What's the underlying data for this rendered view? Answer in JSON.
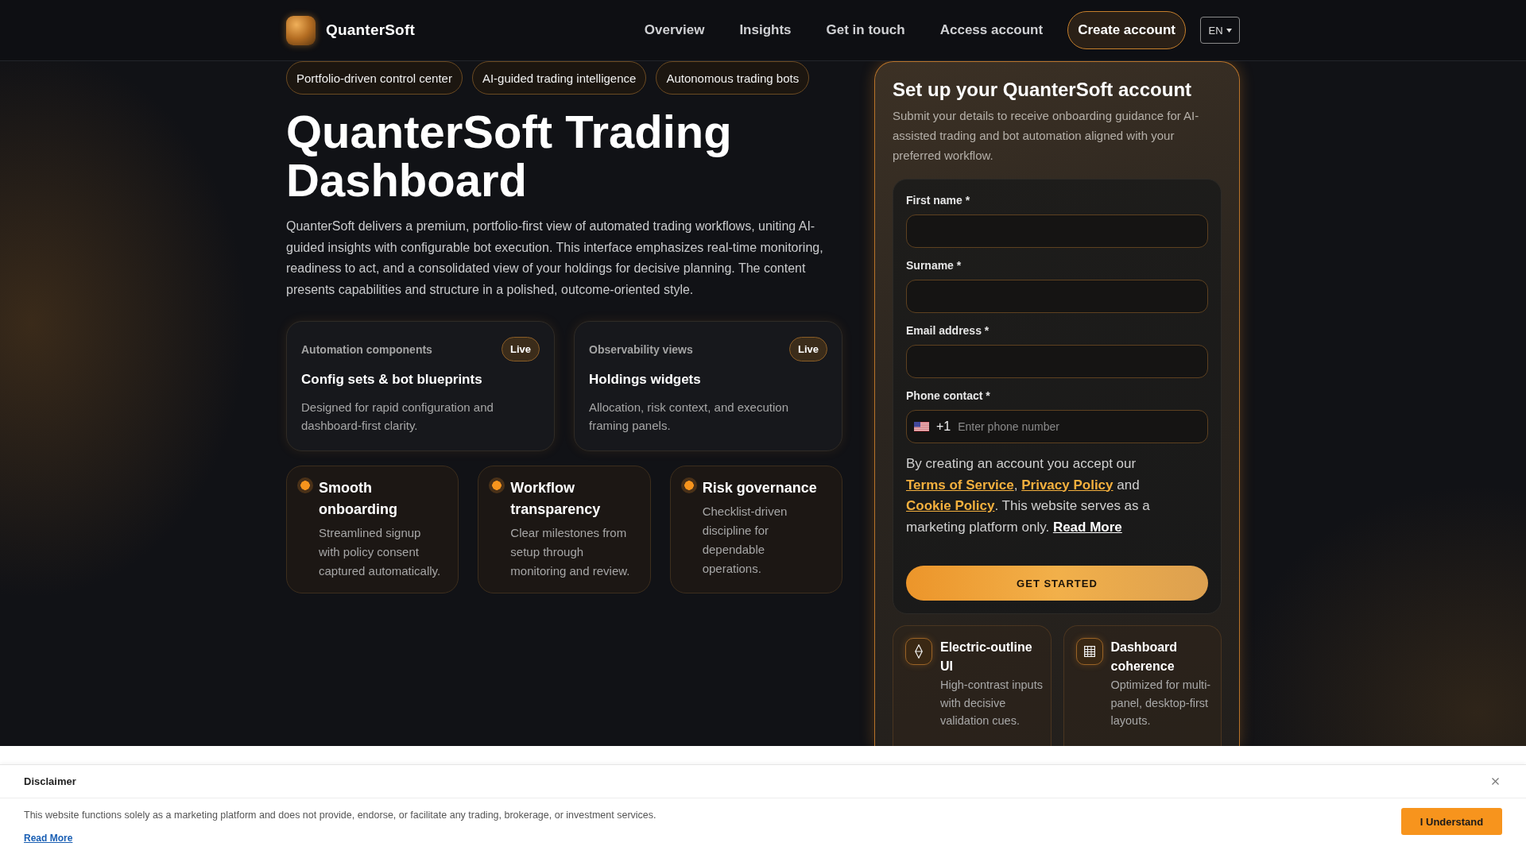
{
  "header": {
    "brand": "QuanterSoft",
    "nav": [
      "Overview",
      "Insights",
      "Get in touch",
      "Access account"
    ],
    "cta": "Create account",
    "language": "EN"
  },
  "hero": {
    "tags": [
      "Portfolio-driven control center",
      "AI-guided trading intelligence",
      "Autonomous trading bots"
    ],
    "title": "QuanterSoft Trading Dashboard",
    "description": "QuanterSoft delivers a premium, portfolio-first view of automated trading workflows, uniting AI-guided insights with configurable bot execution. This interface emphasizes real-time monitoring, readiness to act, and a consolidated view of your holdings for decisive planning. The content presents capabilities and structure in a polished, outcome-oriented style."
  },
  "status_cards": [
    {
      "label": "Automation components",
      "badge": "Live",
      "title": "Config sets & bot blueprints",
      "description": "Designed for rapid configuration and dashboard-first clarity."
    },
    {
      "label": "Observability views",
      "badge": "Live",
      "title": "Holdings widgets",
      "description": "Allocation, risk context, and execution framing panels."
    }
  ],
  "highlights": [
    {
      "title": "Smooth onboarding",
      "description": "Streamlined signup with policy consent captured automatically."
    },
    {
      "title": "Workflow transparency",
      "description": "Clear milestones from setup through monitoring and review."
    },
    {
      "title": "Risk governance",
      "description": "Checklist-driven discipline for dependable operations."
    }
  ],
  "signup": {
    "title": "Set up your QuanterSoft account",
    "subtitle": "Submit your details to receive onboarding guidance for AI-assisted trading and bot automation aligned with your preferred workflow.",
    "fields": [
      {
        "kind": "text",
        "label": "First name *"
      },
      {
        "kind": "text",
        "label": "Surname *"
      },
      {
        "kind": "text",
        "label": "Email address *"
      },
      {
        "kind": "phone",
        "label": "Phone contact *",
        "country_code": "+1",
        "placeholder": "Enter phone number"
      }
    ],
    "consent": [
      {
        "kind": "text",
        "text": "By creating an account you accept our "
      },
      {
        "kind": "link",
        "text": "Terms of Service"
      },
      {
        "kind": "text",
        "text": ", "
      },
      {
        "kind": "link",
        "text": "Privacy Policy"
      },
      {
        "kind": "text",
        "text": " and "
      },
      {
        "kind": "link",
        "text": "Cookie Policy"
      },
      {
        "kind": "text",
        "text": ". This website serves as a marketing platform only. "
      },
      {
        "kind": "more",
        "text": "Read More"
      }
    ],
    "submit": "GET STARTED",
    "features": [
      {
        "title": "Electric-outline UI",
        "description": "High-contrast inputs with decisive validation cues."
      },
      {
        "title": "Dashboard coherence",
        "description": "Optimized for multi-panel, desktop-first layouts."
      }
    ]
  },
  "disclaimer": {
    "title": "Disclaimer",
    "text": "This website functions solely as a marketing platform and does not provide, endorse, or facilitate any trading, brokerage, or investment services.",
    "link": "Read More",
    "button": "I Understand"
  }
}
